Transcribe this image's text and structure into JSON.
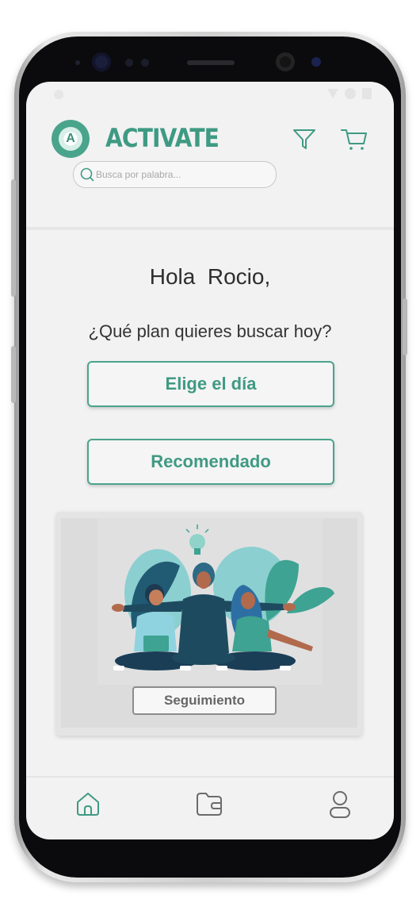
{
  "header": {
    "brand": "ACTIVATE",
    "logo_letter": "A",
    "search_placeholder": "Busca por palabra..."
  },
  "main": {
    "greeting": "Hola  Rocio,",
    "question": "¿Qué plan quieres buscar hoy?",
    "choose_day_label": "Elige el día",
    "recommended_label": "Recomendado",
    "tracking_label": "Seguimiento"
  },
  "nav": {
    "items": [
      "home-icon",
      "wallet-icon",
      "user-icon"
    ]
  },
  "colors": {
    "accent": "#4aa48c",
    "accent_text": "#3f9a83"
  }
}
